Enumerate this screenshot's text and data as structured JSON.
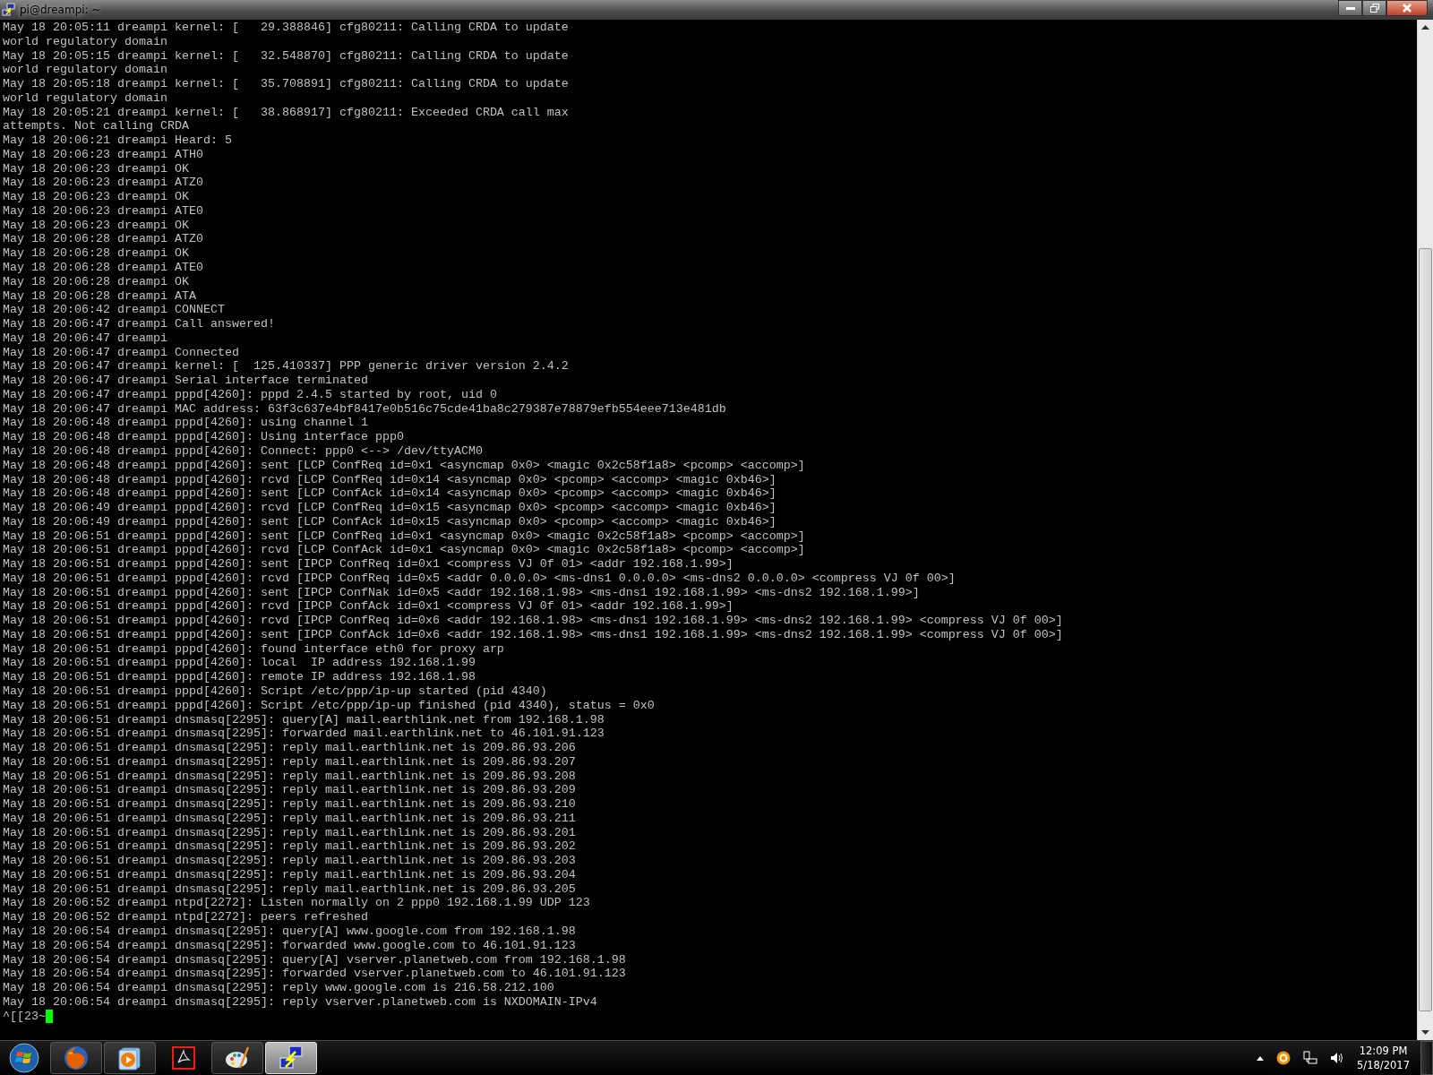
{
  "window": {
    "title": "pi@dreampi: ~"
  },
  "terminal": {
    "lines": [
      "May 18 20:05:11 dreampi kernel: [   29.388846] cfg80211: Calling CRDA to update",
      "world regulatory domain",
      "May 18 20:05:15 dreampi kernel: [   32.548870] cfg80211: Calling CRDA to update",
      "world regulatory domain",
      "May 18 20:05:18 dreampi kernel: [   35.708891] cfg80211: Calling CRDA to update",
      "world regulatory domain",
      "May 18 20:05:21 dreampi kernel: [   38.868917] cfg80211: Exceeded CRDA call max",
      "attempts. Not calling CRDA",
      "May 18 20:06:21 dreampi Heard: 5",
      "May 18 20:06:23 dreampi ATH0",
      "May 18 20:06:23 dreampi OK",
      "May 18 20:06:23 dreampi ATZ0",
      "May 18 20:06:23 dreampi OK",
      "May 18 20:06:23 dreampi ATE0",
      "May 18 20:06:23 dreampi OK",
      "May 18 20:06:28 dreampi ATZ0",
      "May 18 20:06:28 dreampi OK",
      "May 18 20:06:28 dreampi ATE0",
      "May 18 20:06:28 dreampi OK",
      "May 18 20:06:28 dreampi ATA",
      "May 18 20:06:42 dreampi CONNECT",
      "May 18 20:06:47 dreampi Call answered!",
      "May 18 20:06:47 dreampi",
      "May 18 20:06:47 dreampi Connected",
      "May 18 20:06:47 dreampi kernel: [  125.410337] PPP generic driver version 2.4.2",
      "May 18 20:06:47 dreampi Serial interface terminated",
      "May 18 20:06:47 dreampi pppd[4260]: pppd 2.4.5 started by root, uid 0",
      "May 18 20:06:47 dreampi MAC address: 63f3c637e4bf8417e0b516c75cde41ba8c279387e78879efb554eee713e481db",
      "May 18 20:06:48 dreampi pppd[4260]: using channel 1",
      "May 18 20:06:48 dreampi pppd[4260]: Using interface ppp0",
      "May 18 20:06:48 dreampi pppd[4260]: Connect: ppp0 <--> /dev/ttyACM0",
      "May 18 20:06:48 dreampi pppd[4260]: sent [LCP ConfReq id=0x1 <asyncmap 0x0> <magic 0x2c58f1a8> <pcomp> <accomp>]",
      "May 18 20:06:48 dreampi pppd[4260]: rcvd [LCP ConfReq id=0x14 <asyncmap 0x0> <pcomp> <accomp> <magic 0xb46>]",
      "May 18 20:06:48 dreampi pppd[4260]: sent [LCP ConfAck id=0x14 <asyncmap 0x0> <pcomp> <accomp> <magic 0xb46>]",
      "May 18 20:06:49 dreampi pppd[4260]: rcvd [LCP ConfReq id=0x15 <asyncmap 0x0> <pcomp> <accomp> <magic 0xb46>]",
      "May 18 20:06:49 dreampi pppd[4260]: sent [LCP ConfAck id=0x15 <asyncmap 0x0> <pcomp> <accomp> <magic 0xb46>]",
      "May 18 20:06:51 dreampi pppd[4260]: sent [LCP ConfReq id=0x1 <asyncmap 0x0> <magic 0x2c58f1a8> <pcomp> <accomp>]",
      "May 18 20:06:51 dreampi pppd[4260]: rcvd [LCP ConfAck id=0x1 <asyncmap 0x0> <magic 0x2c58f1a8> <pcomp> <accomp>]",
      "May 18 20:06:51 dreampi pppd[4260]: sent [IPCP ConfReq id=0x1 <compress VJ 0f 01> <addr 192.168.1.99>]",
      "May 18 20:06:51 dreampi pppd[4260]: rcvd [IPCP ConfReq id=0x5 <addr 0.0.0.0> <ms-dns1 0.0.0.0> <ms-dns2 0.0.0.0> <compress VJ 0f 00>]",
      "May 18 20:06:51 dreampi pppd[4260]: sent [IPCP ConfNak id=0x5 <addr 192.168.1.98> <ms-dns1 192.168.1.99> <ms-dns2 192.168.1.99>]",
      "May 18 20:06:51 dreampi pppd[4260]: rcvd [IPCP ConfAck id=0x1 <compress VJ 0f 01> <addr 192.168.1.99>]",
      "May 18 20:06:51 dreampi pppd[4260]: rcvd [IPCP ConfReq id=0x6 <addr 192.168.1.98> <ms-dns1 192.168.1.99> <ms-dns2 192.168.1.99> <compress VJ 0f 00>]",
      "May 18 20:06:51 dreampi pppd[4260]: sent [IPCP ConfAck id=0x6 <addr 192.168.1.98> <ms-dns1 192.168.1.99> <ms-dns2 192.168.1.99> <compress VJ 0f 00>]",
      "May 18 20:06:51 dreampi pppd[4260]: found interface eth0 for proxy arp",
      "May 18 20:06:51 dreampi pppd[4260]: local  IP address 192.168.1.99",
      "May 18 20:06:51 dreampi pppd[4260]: remote IP address 192.168.1.98",
      "May 18 20:06:51 dreampi pppd[4260]: Script /etc/ppp/ip-up started (pid 4340)",
      "May 18 20:06:51 dreampi pppd[4260]: Script /etc/ppp/ip-up finished (pid 4340), status = 0x0",
      "May 18 20:06:51 dreampi dnsmasq[2295]: query[A] mail.earthlink.net from 192.168.1.98",
      "May 18 20:06:51 dreampi dnsmasq[2295]: forwarded mail.earthlink.net to 46.101.91.123",
      "May 18 20:06:51 dreampi dnsmasq[2295]: reply mail.earthlink.net is 209.86.93.206",
      "May 18 20:06:51 dreampi dnsmasq[2295]: reply mail.earthlink.net is 209.86.93.207",
      "May 18 20:06:51 dreampi dnsmasq[2295]: reply mail.earthlink.net is 209.86.93.208",
      "May 18 20:06:51 dreampi dnsmasq[2295]: reply mail.earthlink.net is 209.86.93.209",
      "May 18 20:06:51 dreampi dnsmasq[2295]: reply mail.earthlink.net is 209.86.93.210",
      "May 18 20:06:51 dreampi dnsmasq[2295]: reply mail.earthlink.net is 209.86.93.211",
      "May 18 20:06:51 dreampi dnsmasq[2295]: reply mail.earthlink.net is 209.86.93.201",
      "May 18 20:06:51 dreampi dnsmasq[2295]: reply mail.earthlink.net is 209.86.93.202",
      "May 18 20:06:51 dreampi dnsmasq[2295]: reply mail.earthlink.net is 209.86.93.203",
      "May 18 20:06:51 dreampi dnsmasq[2295]: reply mail.earthlink.net is 209.86.93.204",
      "May 18 20:06:51 dreampi dnsmasq[2295]: reply mail.earthlink.net is 209.86.93.205",
      "May 18 20:06:52 dreampi ntpd[2272]: Listen normally on 2 ppp0 192.168.1.99 UDP 123",
      "May 18 20:06:52 dreampi ntpd[2272]: peers refreshed",
      "May 18 20:06:54 dreampi dnsmasq[2295]: query[A] www.google.com from 192.168.1.98",
      "May 18 20:06:54 dreampi dnsmasq[2295]: forwarded www.google.com to 46.101.91.123",
      "May 18 20:06:54 dreampi dnsmasq[2295]: query[A] vserver.planetweb.com from 192.168.1.98",
      "May 18 20:06:54 dreampi dnsmasq[2295]: forwarded vserver.planetweb.com to 46.101.91.123",
      "May 18 20:06:54 dreampi dnsmasq[2295]: reply www.google.com is 216.58.212.100",
      "May 18 20:06:54 dreampi dnsmasq[2295]: reply vserver.planetweb.com is NXDOMAIN-IPv4"
    ],
    "prompt": "^[[23~"
  },
  "taskbar": {
    "apps": [
      {
        "kind": "browser",
        "running": true,
        "selected": false
      },
      {
        "kind": "player",
        "running": true,
        "selected": false
      },
      {
        "kind": "pdf",
        "running": false,
        "selected": false
      },
      {
        "kind": "paint",
        "running": true,
        "selected": false
      },
      {
        "kind": "terminal",
        "running": true,
        "selected": true
      }
    ],
    "clock": {
      "time": "12:09 PM",
      "date": "5/18/2017"
    }
  }
}
